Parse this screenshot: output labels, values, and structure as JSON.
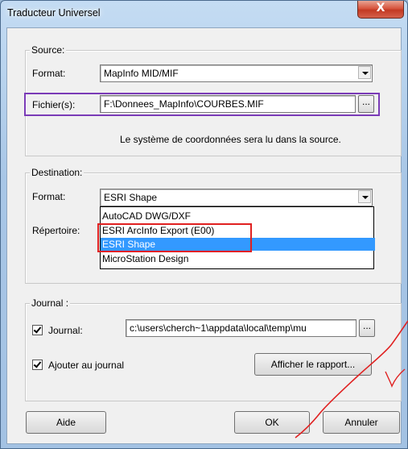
{
  "window": {
    "title": "Traducteur Universel",
    "close_label": "X"
  },
  "source": {
    "legend": "Source:",
    "format_label": "Format:",
    "format_value": "MapInfo MID/MIF",
    "files_label": "Fichier(s):",
    "files_value": "F:\\Donnees_MapInfo\\COURBES.MIF",
    "browse_label": "...",
    "info_text": "Le système de coordonnées sera lu dans la source."
  },
  "destination": {
    "legend": "Destination:",
    "format_label": "Format:",
    "format_value": "ESRI Shape",
    "directory_label": "Répertoire:",
    "dropdown_options": [
      "AutoCAD DWG/DXF",
      "ESRI ArcInfo Export (E00)",
      "ESRI Shape",
      "MicroStation Design"
    ],
    "selected_option": "ESRI Shape"
  },
  "journal": {
    "legend": "Journal :",
    "journal_checkbox_label": "Journal:",
    "journal_checked": true,
    "journal_path": "c:\\users\\cherch~1\\appdata\\local\\temp\\mu",
    "browse_label": "...",
    "append_checkbox_label": "Ajouter au journal",
    "append_checked": true,
    "show_report_label": "Afficher le rapport..."
  },
  "buttons": {
    "help": "Aide",
    "ok": "OK",
    "cancel": "Annuler"
  },
  "colors": {
    "highlight": "#3399ff",
    "annotation_red": "#e02020",
    "annotation_purple": "#7a3bb7"
  }
}
